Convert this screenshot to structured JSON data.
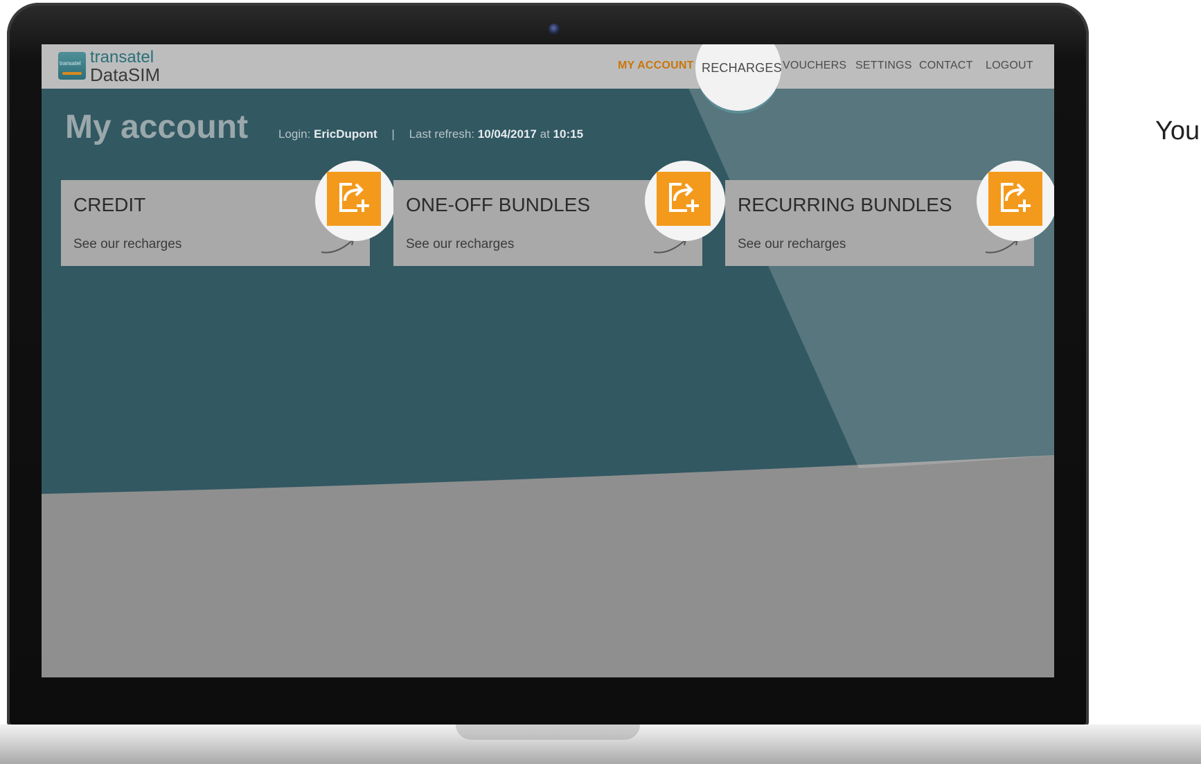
{
  "app": {
    "logo_top": "transatel",
    "logo_bottom": "DataSIM",
    "logo_small": "transatel"
  },
  "nav": {
    "items": [
      {
        "label": "MY ACCOUNT",
        "active": true
      },
      {
        "label": "RECHARGES",
        "highlighted": true
      },
      {
        "label": "VOUCHERS"
      },
      {
        "label": "SETTINGS"
      },
      {
        "label": "CONTACT"
      },
      {
        "label": "LOGOUT"
      }
    ]
  },
  "page": {
    "title": "My account",
    "login_label": "Login:",
    "login_value": "EricDupont",
    "separator": "|",
    "refresh_label": "Last refresh:",
    "refresh_date": "10/04/2017",
    "refresh_at": "at",
    "refresh_time": "10:15"
  },
  "cards": [
    {
      "title": "CREDIT",
      "link": "See our recharges",
      "icon": "recharge-add-icon"
    },
    {
      "title": "ONE-OFF BUNDLES",
      "link": "See our recharges",
      "icon": "recharge-add-icon"
    },
    {
      "title": "RECURRING BUNDLES",
      "link": "See our recharges",
      "icon": "recharge-add-icon"
    }
  ],
  "side_text": "You",
  "colors": {
    "accent": "#F39A1C",
    "nav_active": "#C9760A",
    "teal": "#2F6E78"
  }
}
